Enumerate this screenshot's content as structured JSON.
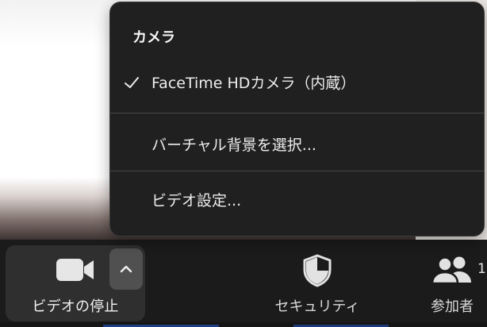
{
  "camera_menu": {
    "header": "カメラ",
    "items": [
      {
        "label": "FaceTime HDカメラ（内蔵）",
        "checked": true
      },
      {
        "label": "バーチャル背景を選択..."
      },
      {
        "label": "ビデオ設定..."
      }
    ]
  },
  "toolbar": {
    "video_label": "ビデオの停止",
    "security_label": "セキュリティ",
    "participants_label": "参加者",
    "participants_count": "1"
  },
  "icons": {
    "video": "video-camera-icon",
    "chevron": "chevron-up-icon",
    "security": "shield-icon",
    "participants": "people-icon",
    "check": "checkmark-icon"
  },
  "colors": {
    "menu_bg": "#202020",
    "toolbar_bg": "#1b1b1b",
    "video_button_bg": "#2f2f2f"
  }
}
